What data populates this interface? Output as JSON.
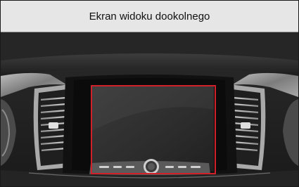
{
  "header": {
    "title": "Ekran widoku dookolnego"
  },
  "image": {
    "subject": "dashboard-photo-icon",
    "highlight_color": "#d0202a"
  }
}
